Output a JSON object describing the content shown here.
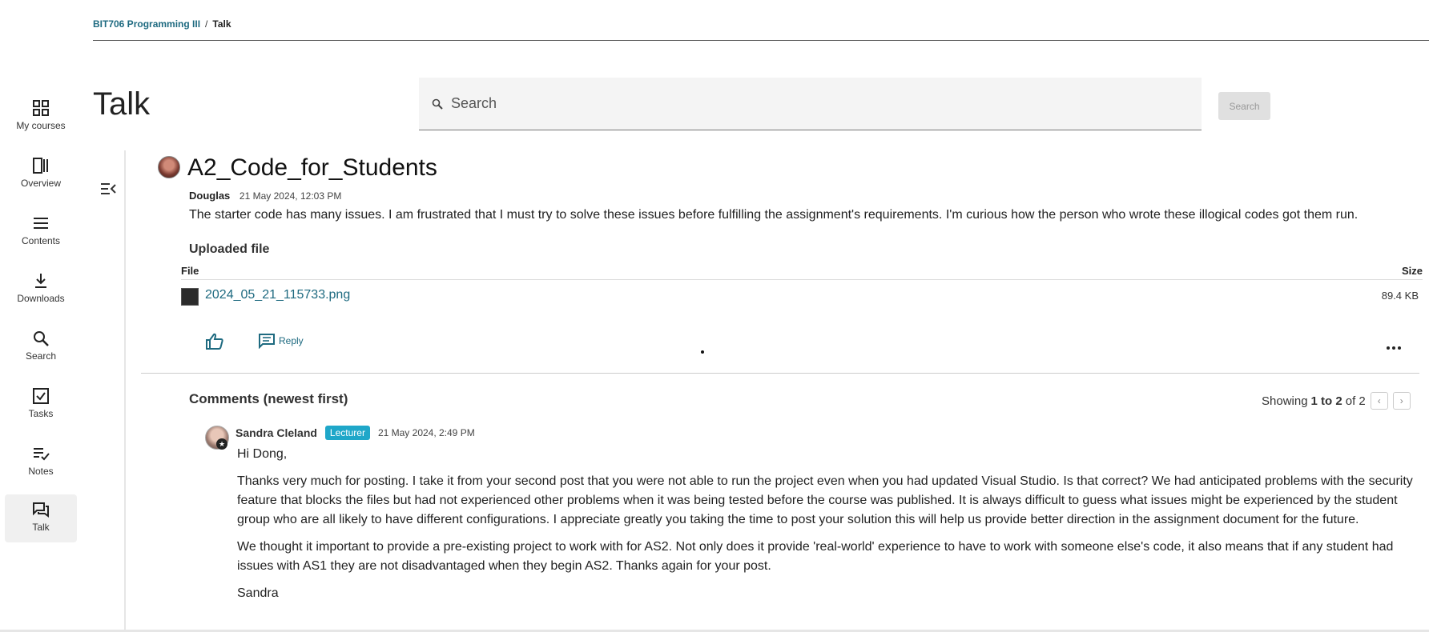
{
  "breadcrumb": {
    "course": "BIT706 Programming III",
    "separator": "/",
    "current": "Talk"
  },
  "page": {
    "title": "Talk"
  },
  "search": {
    "placeholder": "Search",
    "button_label": "Search"
  },
  "sidebar": {
    "items": [
      {
        "label": "My courses",
        "icon": "grid-icon"
      },
      {
        "label": "Overview",
        "icon": "overview-icon"
      },
      {
        "label": "Contents",
        "icon": "list-icon"
      },
      {
        "label": "Downloads",
        "icon": "download-icon"
      },
      {
        "label": "Search",
        "icon": "search-icon"
      },
      {
        "label": "Tasks",
        "icon": "checkbox-icon"
      },
      {
        "label": "Notes",
        "icon": "notes-icon"
      },
      {
        "label": "Talk",
        "icon": "chat-icon",
        "active": true
      }
    ]
  },
  "post": {
    "title": "A2_Code_for_Students",
    "author": "Douglas",
    "timestamp": "21 May 2024, 12:03 PM",
    "body": "The starter code has many issues. I am frustrated that I must try to solve these issues before fulfilling the assignment's requirements. I'm curious how the person who wrote these illogical codes got them run.",
    "uploaded_title": "Uploaded file",
    "file_header": "File",
    "size_header": "Size",
    "file": {
      "name": "2024_05_21_115733.png",
      "size": "89.4 KB"
    },
    "reply_label": "Reply"
  },
  "comments": {
    "title": "Comments (newest first)",
    "paging": {
      "prefix": "Showing",
      "range": "1 to 2",
      "suffix": "of 2"
    },
    "items": [
      {
        "author": "Sandra Cleland",
        "role": "Lecturer",
        "timestamp": "21 May 2024, 2:49 PM",
        "paragraphs": [
          "Hi Dong,",
          "Thanks very much for posting.  I take it from your second post that you were not able to run the project even when you had updated Visual Studio.  Is that correct?  We had anticipated problems with the security feature that blocks the files but had not experienced other problems when it was being tested before the course was published.  It is always difficult to guess what issues might be experienced by the student group who are all likely to have different configurations. I appreciate greatly you taking the time to post your solution this will help us provide better direction in the assignment document for the future.",
          "We thought it important to provide a pre-existing project to work with for AS2.  Not only does it provide 'real-world' experience to have to work with someone else's code, it also means that if any student had issues with AS1 they are not disadvantaged when they begin AS2.  Thanks again for your post.",
          "Sandra"
        ]
      }
    ]
  },
  "colors": {
    "link": "#1e6a80",
    "badge": "#1fa7c9"
  }
}
